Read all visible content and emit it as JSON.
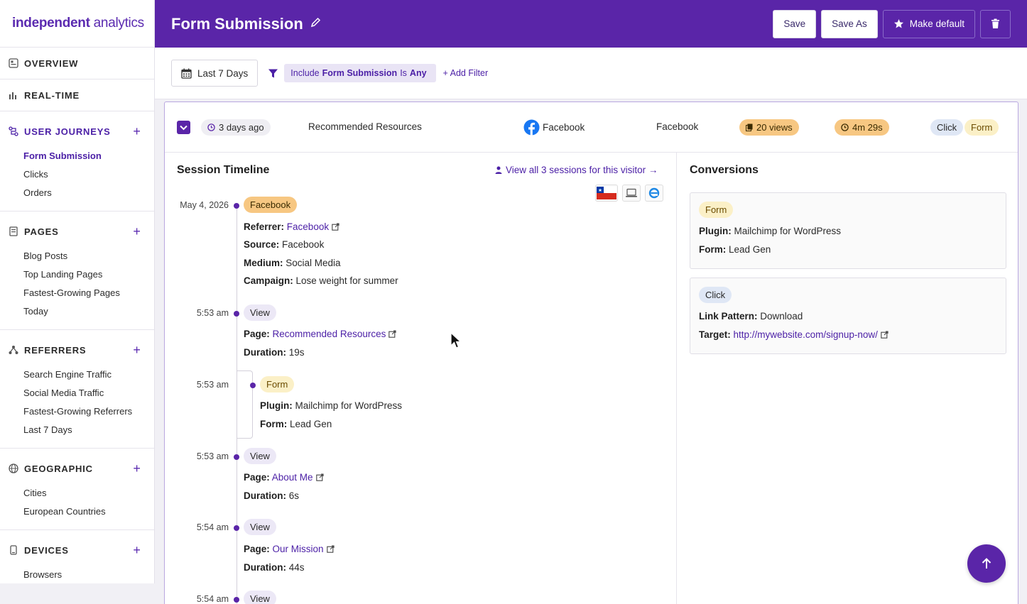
{
  "logo": {
    "part1": "independent",
    "part2": "analytics"
  },
  "sidebar": {
    "sections": [
      {
        "label": "OVERVIEW"
      },
      {
        "label": "REAL-TIME"
      },
      {
        "label": "USER JOURNEYS",
        "items": [
          "Form Submission",
          "Clicks",
          "Orders"
        ]
      },
      {
        "label": "PAGES",
        "items": [
          "Blog Posts",
          "Top Landing Pages",
          "Fastest-Growing Pages",
          "Today"
        ]
      },
      {
        "label": "REFERRERS",
        "items": [
          "Search Engine Traffic",
          "Social Media Traffic",
          "Fastest-Growing Referrers",
          "Last 7 Days"
        ]
      },
      {
        "label": "GEOGRAPHIC",
        "items": [
          "Cities",
          "European Countries"
        ]
      },
      {
        "label": "DEVICES",
        "items": [
          "Browsers"
        ]
      }
    ],
    "plus": "+"
  },
  "header": {
    "title": "Form Submission",
    "save": "Save",
    "save_as": "Save As",
    "make_default": "Make default"
  },
  "filters": {
    "date": "Last 7 Days",
    "include": "Include",
    "field": "Form Submission",
    "is": "Is",
    "value": "Any",
    "add": "+ Add Filter"
  },
  "journey": {
    "when": "3 days ago",
    "landing": "Recommended Resources",
    "referrer": "Facebook",
    "source": "Facebook",
    "views": "20 views",
    "duration": "4m 29s",
    "tag_click": "Click",
    "tag_form": "Form"
  },
  "timeline": {
    "title": "Session Timeline",
    "view_all": "View all 3 sessions for this visitor →",
    "date": "May 4, 2026",
    "first_tag": "Facebook",
    "referrer_label": "Referrer:",
    "referrer_value": "Facebook",
    "source_label": "Source:",
    "source_value": "Facebook",
    "medium_label": "Medium:",
    "medium_value": "Social Media",
    "campaign_label": "Campaign:",
    "campaign_value": "Lose weight for summer",
    "events": [
      {
        "time": "5:53 am",
        "tag": "View",
        "page_label": "Page:",
        "page": "Recommended Resources",
        "dur_label": "Duration:",
        "duration": "19s"
      },
      {
        "time": "5:53 am",
        "tag": "Form",
        "plugin_label": "Plugin:",
        "plugin": "Mailchimp for WordPress",
        "form_label": "Form:",
        "form": "Lead Gen"
      },
      {
        "time": "5:53 am",
        "tag": "View",
        "page_label": "Page:",
        "page": "About Me",
        "dur_label": "Duration:",
        "duration": "6s"
      },
      {
        "time": "5:54 am",
        "tag": "View",
        "page_label": "Page:",
        "page": "Our Mission",
        "dur_label": "Duration:",
        "duration": "44s"
      },
      {
        "time": "5:54 am",
        "tag": "View"
      }
    ]
  },
  "conversions": {
    "title": "Conversions",
    "form": {
      "tag": "Form",
      "plugin_label": "Plugin:",
      "plugin": "Mailchimp for WordPress",
      "form_label": "Form:",
      "form": "Lead Gen"
    },
    "click": {
      "tag": "Click",
      "pattern_label": "Link Pattern:",
      "pattern": "Download",
      "target_label": "Target:",
      "target": "http://mywebsite.com/signup-now/"
    }
  },
  "colors": {
    "brand": "#5a25a8",
    "orange": "#f7c782",
    "blue_tag": "#dfe7f5",
    "yellow_tag": "#fbf0c7"
  }
}
